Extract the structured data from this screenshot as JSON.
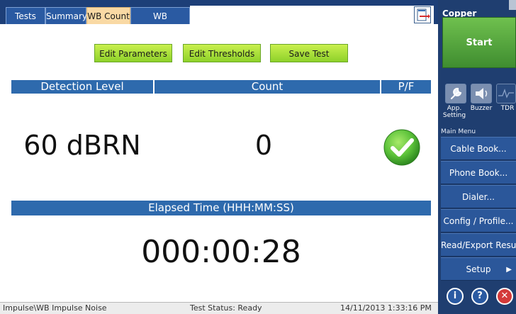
{
  "tabs": [
    {
      "label": "Tests",
      "active": false
    },
    {
      "label": "Summary",
      "active": false
    },
    {
      "label": "WB Count",
      "active": true
    },
    {
      "label": "WB Histogram",
      "active": false
    }
  ],
  "toolbar": {
    "edit_parameters": "Edit Parameters",
    "edit_thresholds": "Edit Thresholds",
    "save_test": "Save Test",
    "export_icon": "export-icon"
  },
  "results": {
    "headers": {
      "detection_level": "Detection Level",
      "count": "Count",
      "pf": "P/F"
    },
    "detection_level": "60 dBRN",
    "count": "0",
    "pf_status": "pass",
    "pf_icon": "checkmark-pass-icon"
  },
  "elapsed": {
    "header": "Elapsed Time (HHH:MM:SS)",
    "value": "000:00:28"
  },
  "status_bar": {
    "path": "Impulse\\WB Impulse Noise",
    "status": "Test Status: Ready",
    "timestamp": "14/11/2013 1:33:16 PM"
  },
  "side_panel": {
    "title": "Copper",
    "start": "Start",
    "tools": [
      {
        "label": "App. Setting",
        "icon": "wrench-icon"
      },
      {
        "label": "Buzzer",
        "icon": "speaker-icon"
      },
      {
        "label": "TDR",
        "icon": "waveform-icon"
      }
    ],
    "main_menu_label": "Main Menu",
    "menu": [
      "Cable Book...",
      "Phone Book...",
      "Dialer...",
      "Config / Profile...",
      "Read/Export Result...",
      "Setup"
    ],
    "bottom_icons": [
      "info-icon",
      "help-icon",
      "close-icon"
    ]
  },
  "colors": {
    "tab_bar": "#1d3f78",
    "active_tab": "#f9d9a4",
    "header_blue": "#2e6aad",
    "green_button": "#a7e03c",
    "start_green": "#4fa43a",
    "side_panel": "#1f3e70",
    "pass_green": "#5cc23a",
    "close_red": "#d43a3a"
  }
}
